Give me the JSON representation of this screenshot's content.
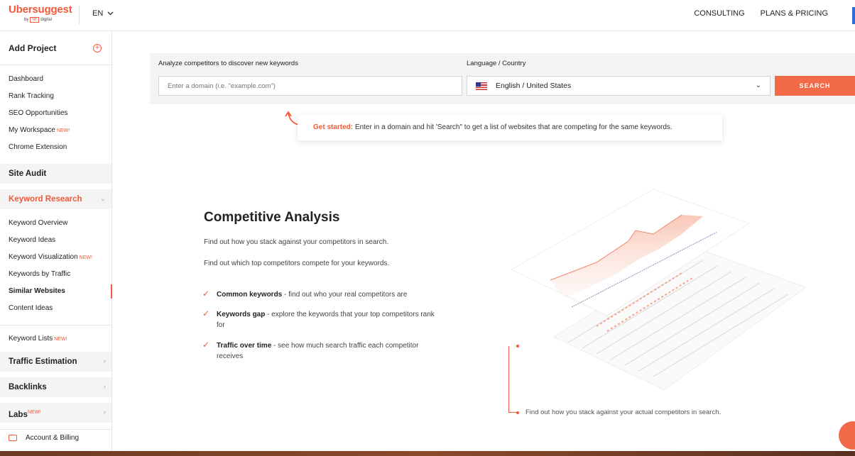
{
  "header": {
    "logo": "Ubersuggest",
    "logo_by": "by",
    "logo_np": "NP",
    "logo_digital": "digital",
    "language": "EN",
    "nav": [
      "CONSULTING",
      "PLANS & PRICING"
    ]
  },
  "sidebar": {
    "add_project": "Add Project",
    "top_items": [
      {
        "label": "Dashboard"
      },
      {
        "label": "Rank Tracking"
      },
      {
        "label": "SEO Opportunities"
      },
      {
        "label": "My Workspace",
        "badge": "NEW!"
      },
      {
        "label": "Chrome Extension"
      }
    ],
    "site_audit": "Site Audit",
    "keyword_research": "Keyword Research",
    "kr_items": [
      {
        "label": "Keyword Overview"
      },
      {
        "label": "Keyword Ideas"
      },
      {
        "label": "Keyword Visualization",
        "badge": "NEW!"
      },
      {
        "label": "Keywords by Traffic"
      },
      {
        "label": "Similar Websites"
      },
      {
        "label": "Content Ideas"
      }
    ],
    "keyword_lists": "Keyword Lists",
    "keyword_lists_badge": "NEW!",
    "traffic_estimation": "Traffic Estimation",
    "backlinks": "Backlinks",
    "labs": "Labs",
    "labs_badge": "NEW!",
    "account_billing": "Account & Billing"
  },
  "search": {
    "domain_label": "Analyze competitors to discover new keywords",
    "domain_placeholder": "Enter a domain (i.e. \"example.com\")",
    "lang_label": "Language / Country",
    "lang_value": "English / United States",
    "button": "SEARCH"
  },
  "hint": {
    "lead": "Get started:",
    "text": " Enter in a domain and hit 'Search\" to get a list of websites that are competing for the same keywords."
  },
  "content": {
    "title": "Competitive Analysis",
    "p1": "Find out how you stack against your competitors in search.",
    "p2": "Find out which top competitors compete for your keywords.",
    "features": [
      {
        "bold": "Common keywords",
        "text": " - find out who your real competitors are"
      },
      {
        "bold": "Keywords gap",
        "text": " - explore the keywords that your top competitors rank for"
      },
      {
        "bold": "Traffic over time",
        "text": " - see how much search traffic each competitor receives"
      }
    ],
    "caption": "Find out how you stack against your actual competitors in search."
  },
  "colors": {
    "accent": "#f05a3a",
    "button": "#f26a48"
  }
}
